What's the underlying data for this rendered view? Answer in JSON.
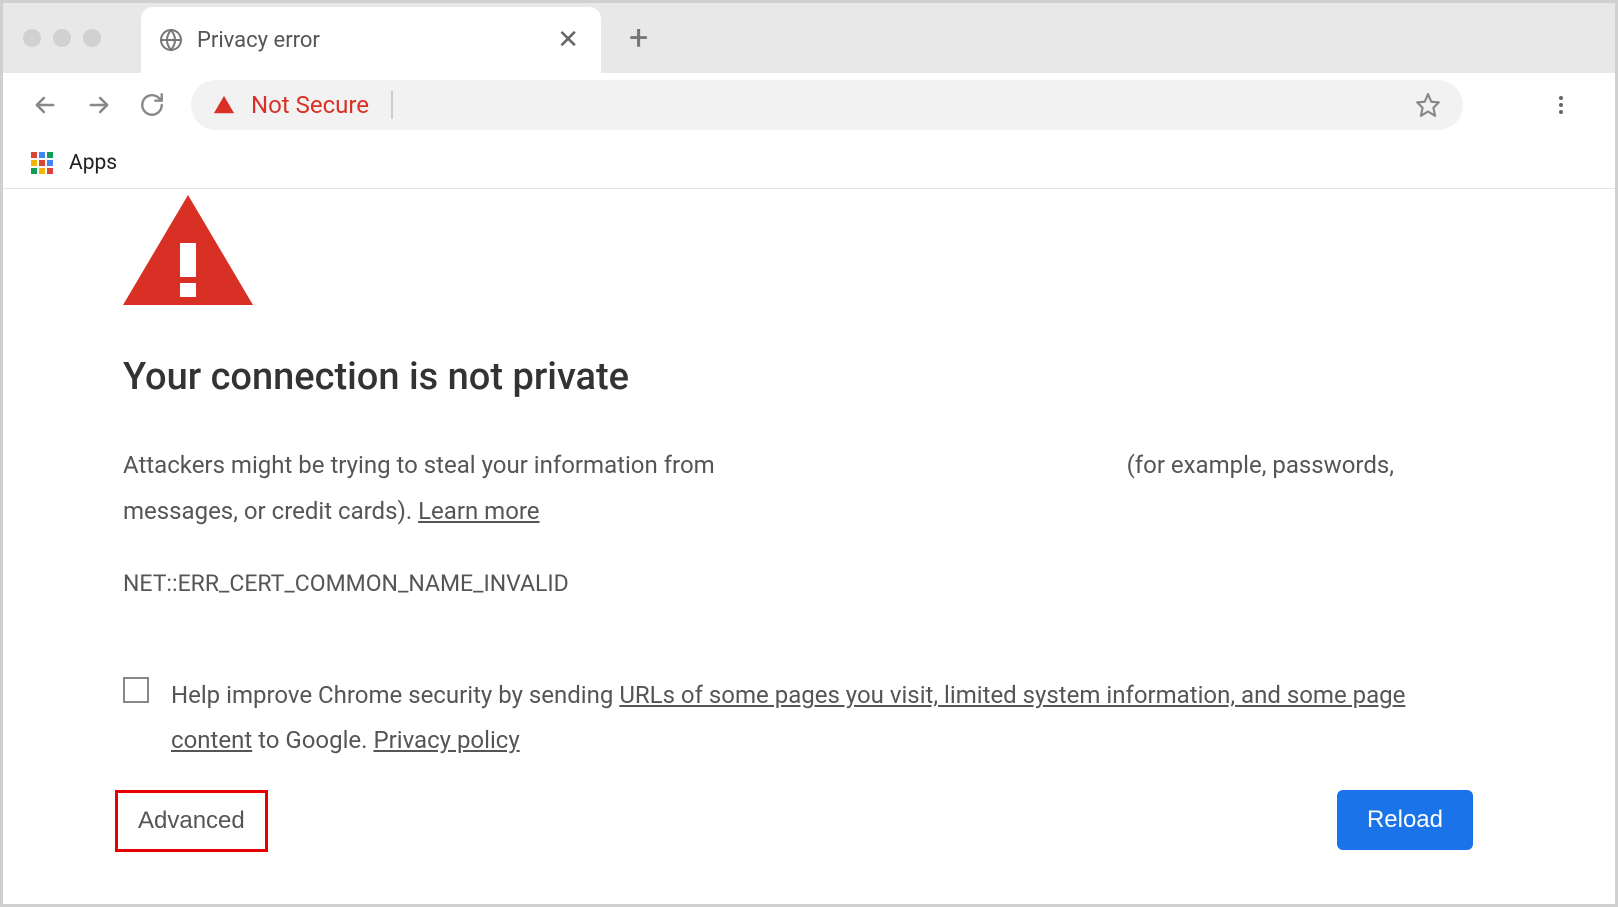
{
  "tab": {
    "title": "Privacy error"
  },
  "toolbar": {
    "secure_label": "Not Secure"
  },
  "bookmarks": {
    "apps_label": "Apps"
  },
  "page": {
    "heading": "Your connection is not private",
    "body_part1": "Attackers might be trying to steal your information from",
    "body_part2": "(for example, passwords, messages, or credit cards).",
    "learn_more": "Learn more",
    "error_code": "NET::ERR_CERT_COMMON_NAME_INVALID",
    "checkbox_part1": "Help improve Chrome security by sending",
    "checkbox_link1": "URLs of some pages you visit, limited system information, and some page content",
    "checkbox_part2": "to Google.",
    "privacy_link": "Privacy policy",
    "advanced_label": "Advanced",
    "reload_label": "Reload"
  }
}
